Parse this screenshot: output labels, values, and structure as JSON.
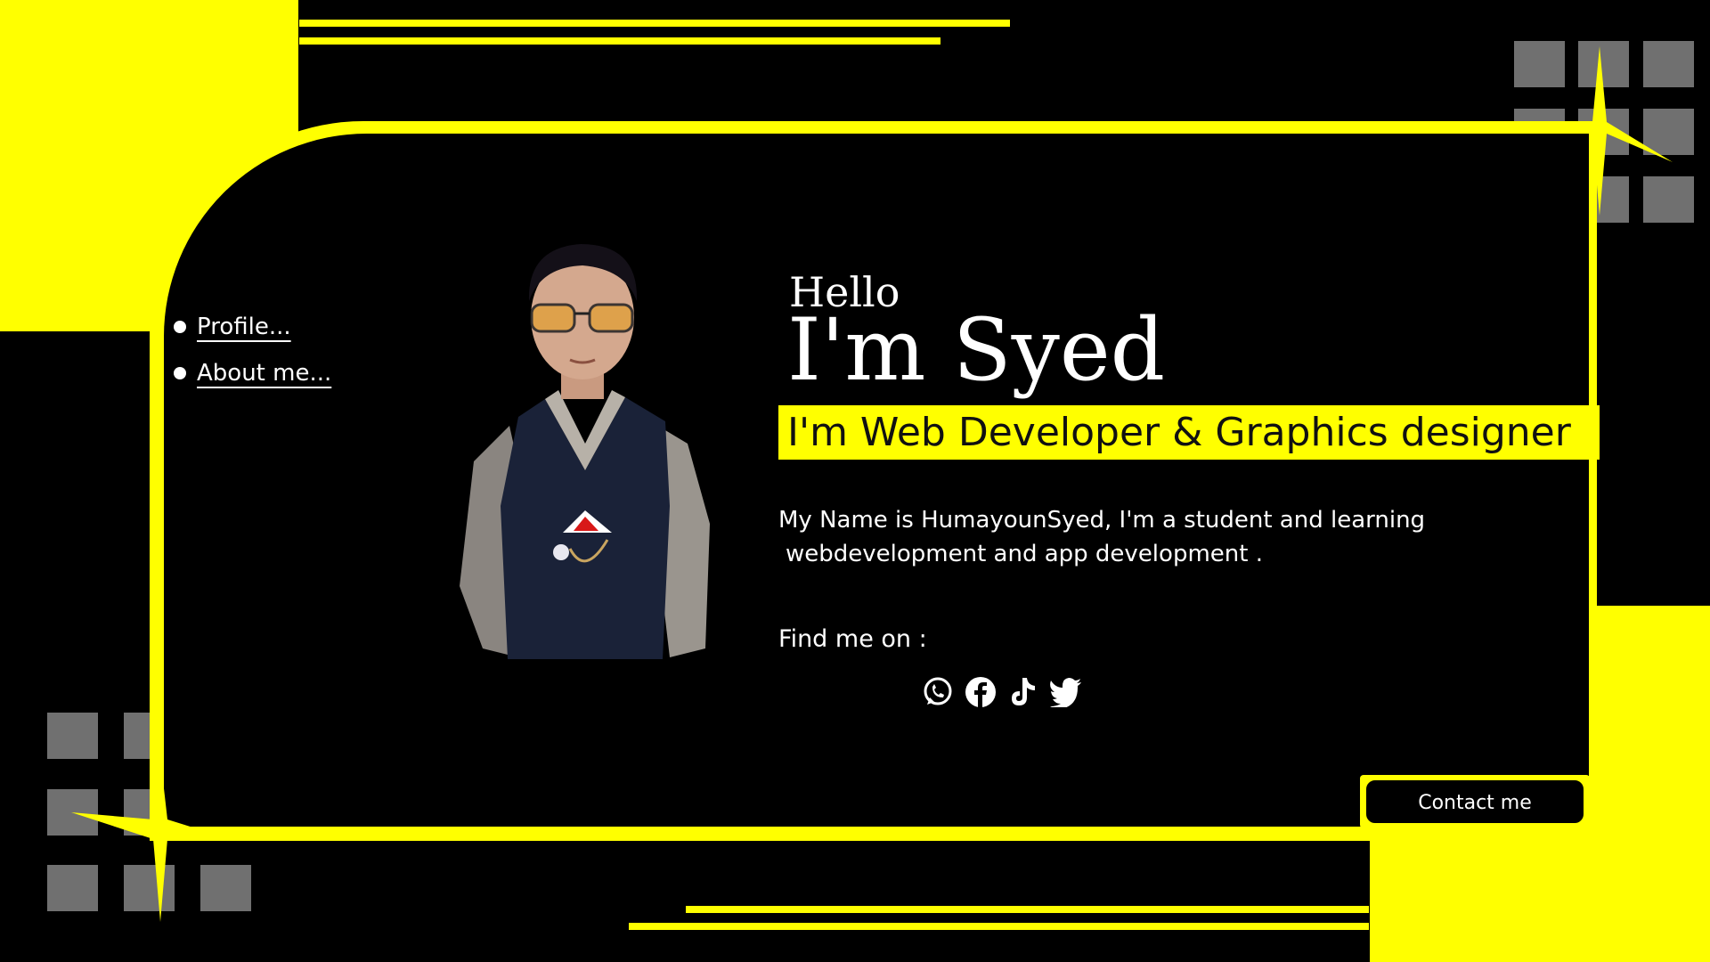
{
  "nav": {
    "items": [
      {
        "label": "Profile..."
      },
      {
        "label": "About me..."
      }
    ]
  },
  "hero": {
    "greeting": "Hello",
    "name": "I'm Syed",
    "role": "I'm Web Developer & Graphics designer",
    "description_line1": "My Name is HumayounSyed, I'm a student and learning",
    "description_line2": "webdevelopment and app development .",
    "find_label": "Find me on :"
  },
  "socials": [
    {
      "icon": "whatsapp-icon"
    },
    {
      "icon": "facebook-icon"
    },
    {
      "icon": "tiktok-icon"
    },
    {
      "icon": "twitter-icon"
    }
  ],
  "contact": {
    "label": "Contact me"
  },
  "colors": {
    "accent": "#ffff00",
    "background": "#000000",
    "text": "#ffffff",
    "tile": "#707070"
  }
}
